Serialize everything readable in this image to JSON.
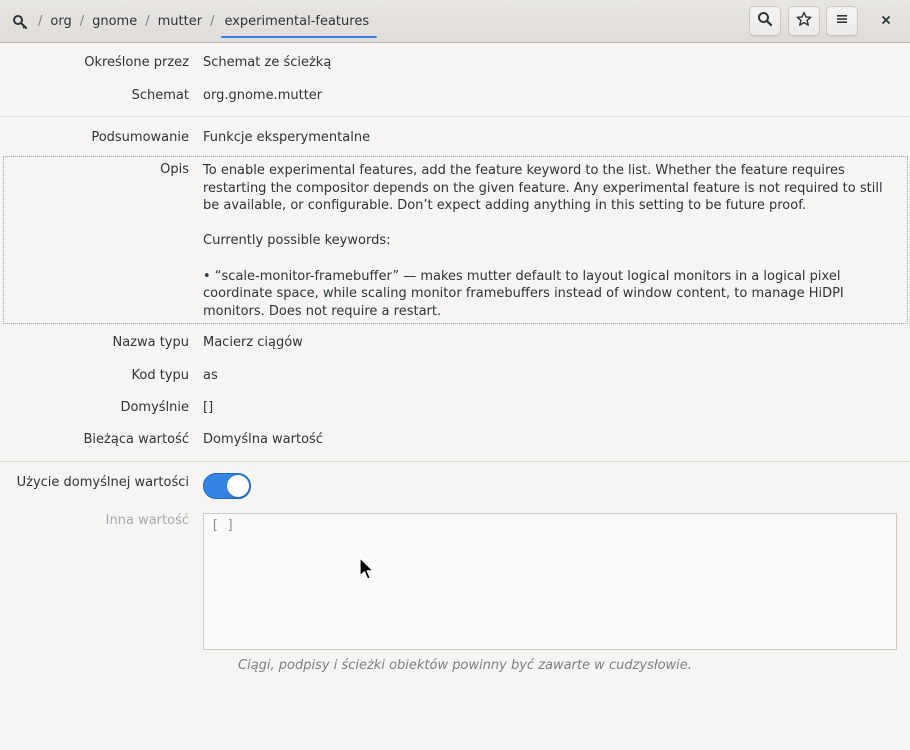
{
  "header": {
    "root_icon": "search-key-icon",
    "breadcrumb": {
      "separator": "/",
      "items": [
        "org",
        "gnome",
        "mutter",
        "experimental-features"
      ]
    },
    "buttons": {
      "search_icon": "search-icon",
      "bookmark_icon": "star-icon",
      "menu_icon": "hamburger-menu-icon",
      "close_icon": "close-icon"
    }
  },
  "fields": {
    "defined_by": {
      "label": "Określone przez",
      "value": "Schemat ze ścieżką"
    },
    "schema": {
      "label": "Schemat",
      "value": "org.gnome.mutter"
    },
    "summary": {
      "label": "Podsumowanie",
      "value": "Funkcje eksperymentalne"
    },
    "description": {
      "label": "Opis",
      "paragraph1": "To enable experimental features, add the feature keyword to the list. Whether the feature requires restarting the compositor depends on the given feature. Any experimental feature is not required to still be available, or configurable. Don’t expect adding anything in this setting to be future proof.",
      "paragraph2": "Currently possible keywords:",
      "paragraph3": "• “scale-monitor-framebuffer” — makes mutter default to layout logical monitors in a logical pixel coordinate space, while scaling monitor framebuffers instead of window content, to manage HiDPI monitors. Does not require a restart."
    },
    "type_name": {
      "label": "Nazwa typu",
      "value": "Macierz ciągów"
    },
    "type_code": {
      "label": "Kod typu",
      "value": "as"
    },
    "default": {
      "label": "Domyślnie",
      "value": "[]"
    },
    "current_value": {
      "label": "Bieżąca wartość",
      "value": "Domyślna wartość"
    }
  },
  "use_default": {
    "label": "Użycie domyślnej wartości",
    "enabled": true
  },
  "custom_value": {
    "label": "Inna wartość",
    "text": "[ ]",
    "hint": "Ciągi, podpisy i ścieżki obiektów powinny być zawarte w cudzysłowie."
  },
  "colors": {
    "accent": "#3584e4",
    "background": "#f6f5f4",
    "header": "#dfdcd8"
  }
}
